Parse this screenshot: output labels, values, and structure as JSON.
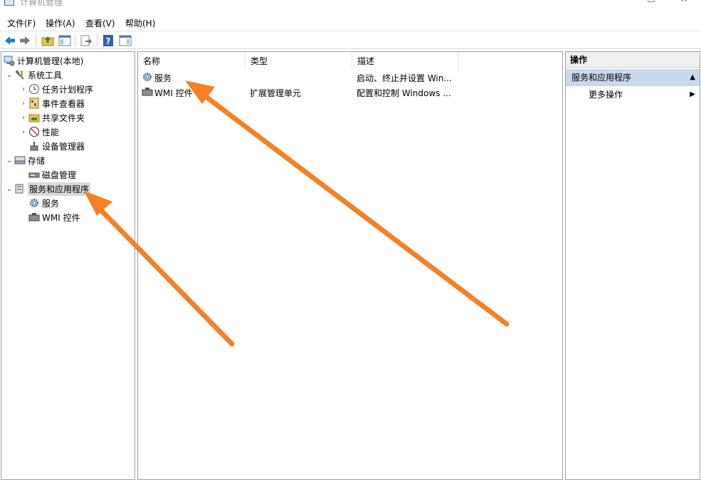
{
  "window": {
    "title": "计算机管理",
    "controls": [
      "—",
      "☐",
      "✕"
    ]
  },
  "menu": [
    "文件(F)",
    "操作(A)",
    "查看(V)",
    "帮助(H)"
  ],
  "toolbar": {
    "buttons": [
      "back-icon",
      "forward-icon",
      "up-folder-icon",
      "show-tree-icon",
      "export-icon",
      "help-icon",
      "show-action-pane-icon"
    ]
  },
  "tree": {
    "root": "计算机管理(本地)",
    "system_tools": "系统工具",
    "task_scheduler": "任务计划程序",
    "event_viewer": "事件查看器",
    "shared_folders": "共享文件夹",
    "performance": "性能",
    "device_manager": "设备管理器",
    "storage": "存储",
    "disk_management": "磁盘管理",
    "services_apps": "服务和应用程序",
    "services": "服务",
    "wmi": "WMI 控件"
  },
  "list": {
    "headers": {
      "name": "名称",
      "type": "类型",
      "desc": "描述"
    },
    "rows": [
      {
        "name": "服务",
        "type": "",
        "desc": "启动、终止并设置 Win..."
      },
      {
        "name": "WMI 控件",
        "type": "扩展管理单元",
        "desc": "配置和控制 Windows ..."
      }
    ]
  },
  "actions": {
    "title": "操作",
    "section": "服务和应用程序",
    "more": "更多操作"
  },
  "annotation": {
    "arrow_color": "#f58025"
  }
}
